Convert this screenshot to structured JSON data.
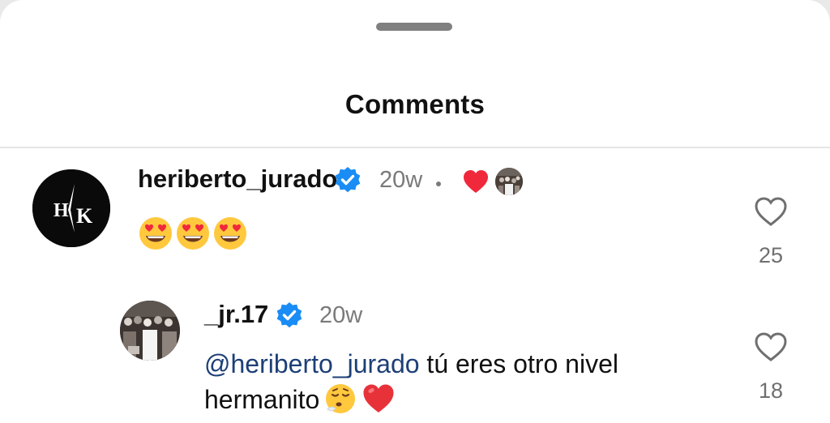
{
  "sheet": {
    "title": "Comments"
  },
  "comments": [
    {
      "username": "heriberto_jurado",
      "verified": true,
      "time": "20w",
      "liked_by_creator": true,
      "avatar_text": "HK",
      "text": "😍😍😍",
      "likes": "25"
    }
  ],
  "replies": [
    {
      "username": "_jr.17",
      "verified": true,
      "time": "20w",
      "mention": "@heriberto_jurado",
      "text_line1_rest": " tú eres otro nivel",
      "text_line2": "hermanito",
      "emojis_after": "😮‍💨❤️",
      "likes": "18"
    }
  ],
  "icons": {
    "verified": "verified-badge-icon",
    "like": "heart-outline-icon",
    "creator_like": "red-heart-icon"
  },
  "colors": {
    "verified_blue": "#1a8cf5",
    "heart_red": "#f0283c",
    "mention": "#1d3f77",
    "secondary_text": "#7a7a7a"
  }
}
